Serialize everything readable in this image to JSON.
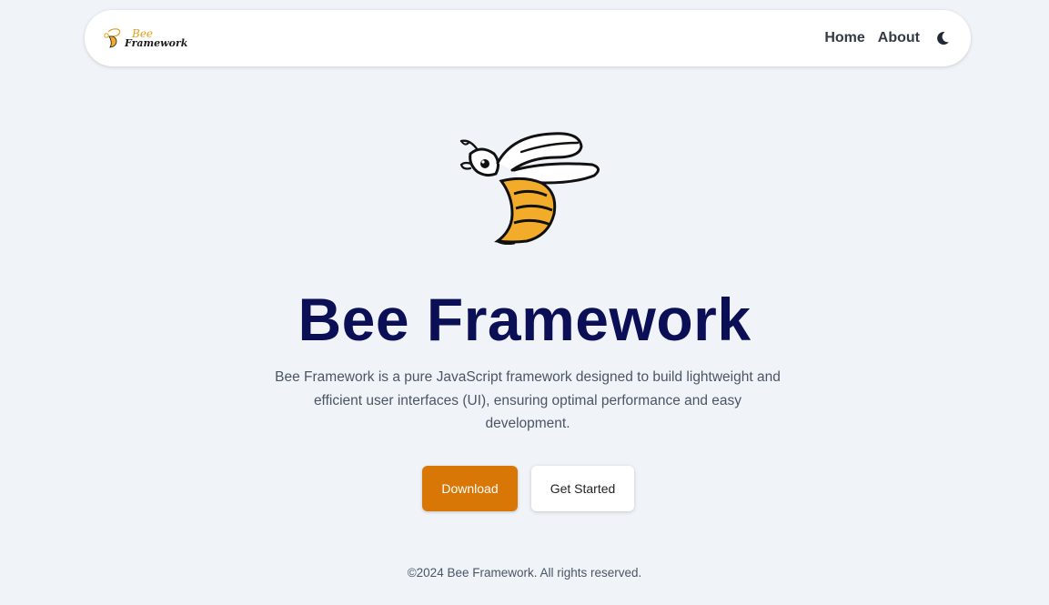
{
  "header": {
    "brand": {
      "word_top": "Bee",
      "word_bottom": "Framework"
    },
    "nav": [
      {
        "label": "Home"
      },
      {
        "label": "About"
      }
    ],
    "theme_toggle_icon": "moon-icon"
  },
  "hero": {
    "logo_icon": "bee-icon",
    "title": "Bee Framework",
    "description": "Bee Framework is a pure JavaScript framework designed to build lightweight and efficient user interfaces (UI), ensuring optimal performance and easy development.",
    "primary_button": "Download",
    "secondary_button": "Get Started"
  },
  "footer": {
    "copyright": "©2024 Bee Framework. All rights reserved."
  },
  "colors": {
    "background": "#f0f3f8",
    "title": "#0b0f55",
    "accent": "#d97706",
    "bee_yellow": "#f2ac2a"
  }
}
